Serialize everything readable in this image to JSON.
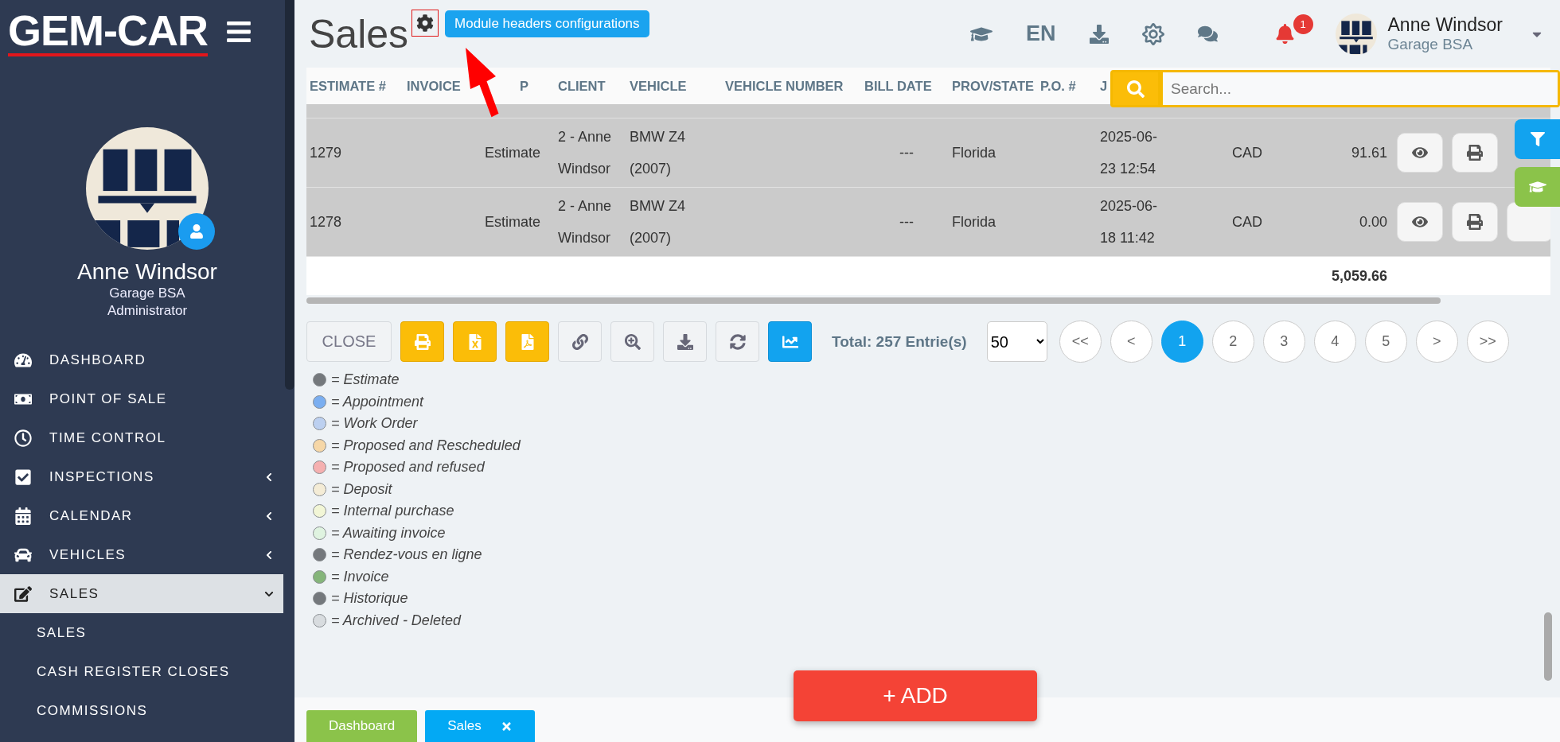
{
  "sidebar": {
    "logo": "GEM-CAR",
    "profile": {
      "name": "Anne Windsor",
      "company": "Garage BSA",
      "role": "Administrator"
    },
    "nav": [
      {
        "label": "DASHBOARD",
        "expandable": false,
        "selected": false
      },
      {
        "label": "POINT OF SALE",
        "expandable": false,
        "selected": false
      },
      {
        "label": "TIME CONTROL",
        "expandable": false,
        "selected": false
      },
      {
        "label": "INSPECTIONS",
        "expandable": true,
        "expanded": false,
        "selected": false
      },
      {
        "label": "CALENDAR",
        "expandable": true,
        "expanded": false,
        "selected": false
      },
      {
        "label": "VEHICLES",
        "expandable": true,
        "expanded": false,
        "selected": false
      },
      {
        "label": "SALES",
        "expandable": true,
        "expanded": true,
        "selected": true,
        "children": [
          {
            "label": "SALES"
          },
          {
            "label": "CASH REGISTER CLOSES"
          },
          {
            "label": "COMMISSIONS"
          }
        ]
      }
    ]
  },
  "header": {
    "title": "Sales",
    "tooltip": "Module headers configurations",
    "language": "EN",
    "notification_count": "1",
    "user": {
      "name": "Anne Windsor",
      "company": "Garage BSA"
    }
  },
  "search": {
    "placeholder": "Search..."
  },
  "table": {
    "columns": [
      "ESTIMATE #",
      "INVOICE",
      "P",
      "CLIENT",
      "VEHICLE",
      "VEHICLE NUMBER",
      "BILL DATE",
      "PROV/STATE",
      "P.O. #",
      "J"
    ],
    "rows": [
      {
        "estimate": "1279",
        "type": "Estimate",
        "client": "2 - Anne Windsor",
        "vehicle": "BMW Z4 (2007)",
        "bill_date": "---",
        "prov_state": "Florida",
        "date": "2025-06-23 12:54",
        "currency": "CAD",
        "total": "91.61"
      },
      {
        "estimate": "1278",
        "type": "Estimate",
        "client": "2 - Anne Windsor",
        "vehicle": "BMW Z4 (2007)",
        "bill_date": "---",
        "prov_state": "Florida",
        "date": "2025-06-18 11:42",
        "currency": "CAD",
        "total": "0.00"
      }
    ],
    "grand_total": "5,059.66"
  },
  "toolbar": {
    "close": "CLOSE",
    "total": "Total: 257 Entrie(s)",
    "page_size": "50",
    "pages": [
      {
        "label": "<<",
        "selected": false
      },
      {
        "label": "<",
        "selected": false
      },
      {
        "label": "1",
        "selected": true
      },
      {
        "label": "2",
        "selected": false
      },
      {
        "label": "3",
        "selected": false
      },
      {
        "label": "4",
        "selected": false
      },
      {
        "label": "5",
        "selected": false
      },
      {
        "label": ">",
        "selected": false
      },
      {
        "label": ">>",
        "selected": false
      }
    ]
  },
  "legend": [
    {
      "label": "= Estimate",
      "color": "#74787c"
    },
    {
      "label": "= Appointment",
      "color": "#7aaef0"
    },
    {
      "label": "= Work Order",
      "color": "#bcd0f0"
    },
    {
      "label": "= Proposed and Rescheduled",
      "color": "#f6d7a7"
    },
    {
      "label": "= Proposed and refused",
      "color": "#f5b0b0"
    },
    {
      "label": "= Deposit",
      "color": "#f4ecd6"
    },
    {
      "label": "= Internal purchase",
      "color": "#f2f6d6"
    },
    {
      "label": "= Awaiting invoice",
      "color": "#dff3e0"
    },
    {
      "label": "= Rendez-vous en ligne",
      "color": "#74787c"
    },
    {
      "label": "= Invoice",
      "color": "#85b57a"
    },
    {
      "label": "= Historique",
      "color": "#74787c"
    },
    {
      "label": "= Archived - Deleted",
      "color": "#d8dcdf"
    }
  ],
  "add_button": "+ ADD",
  "tabs": [
    {
      "label": "Dashboard",
      "color": "#8bc34a",
      "closable": false
    },
    {
      "label": "Sales",
      "color": "#03a9f4",
      "closable": true
    }
  ]
}
